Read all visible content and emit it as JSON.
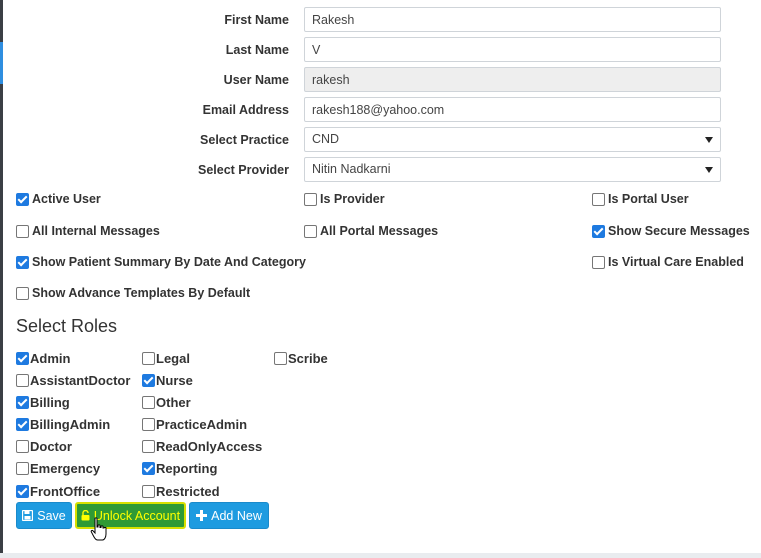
{
  "form": {
    "first_name": {
      "label": "First Name",
      "value": "Rakesh"
    },
    "last_name": {
      "label": "Last Name",
      "value": "V"
    },
    "user_name": {
      "label": "User Name",
      "value": "rakesh"
    },
    "email": {
      "label": "Email Address",
      "value": "rakesh188@yahoo.com"
    },
    "practice": {
      "label": "Select Practice",
      "value": "CND"
    },
    "provider": {
      "label": "Select Provider",
      "value": "Nitin Nadkarni"
    }
  },
  "options": [
    {
      "label": "Active User",
      "checked": true
    },
    {
      "label": "Is Provider",
      "checked": false
    },
    {
      "label": "Is Portal User",
      "checked": false
    },
    {
      "label": "All Internal Messages",
      "checked": false
    },
    {
      "label": "All Portal Messages",
      "checked": false
    },
    {
      "label": "Show Secure Messages",
      "checked": true
    },
    {
      "label": "Show Patient Summary By Date And Category",
      "checked": true
    },
    {
      "label": "Is Virtual Care Enabled",
      "checked": false
    },
    {
      "label": "Show Advance Templates By Default",
      "checked": false
    }
  ],
  "roles_title": "Select Roles",
  "roles": [
    {
      "label": "Admin",
      "checked": true
    },
    {
      "label": "Legal",
      "checked": false
    },
    {
      "label": "Scribe",
      "checked": false
    },
    {
      "label": "AssistantDoctor",
      "checked": false
    },
    {
      "label": "Nurse",
      "checked": true
    },
    {
      "label": "Billing",
      "checked": true
    },
    {
      "label": "Other",
      "checked": false
    },
    {
      "label": "BillingAdmin",
      "checked": true
    },
    {
      "label": "PracticeAdmin",
      "checked": false
    },
    {
      "label": "Doctor",
      "checked": false
    },
    {
      "label": "ReadOnlyAccess",
      "checked": false
    },
    {
      "label": "Emergency",
      "checked": false
    },
    {
      "label": "Reporting",
      "checked": true
    },
    {
      "label": "FrontOffice",
      "checked": true
    },
    {
      "label": "Restricted",
      "checked": false
    }
  ],
  "buttons": {
    "save": "Save",
    "unlock": "Unlock Account",
    "add_new": "Add New"
  },
  "icons": {
    "save": "floppy-disk-icon",
    "unlock": "unlock-icon",
    "add_new": "plus-icon",
    "cursor": "hand-pointer-cursor"
  },
  "colors": {
    "primary_button": "#1e9be0",
    "unlock_button": "#2f9a35",
    "unlock_text": "#ffff00",
    "checkbox_checked": "#1e7ae0"
  }
}
